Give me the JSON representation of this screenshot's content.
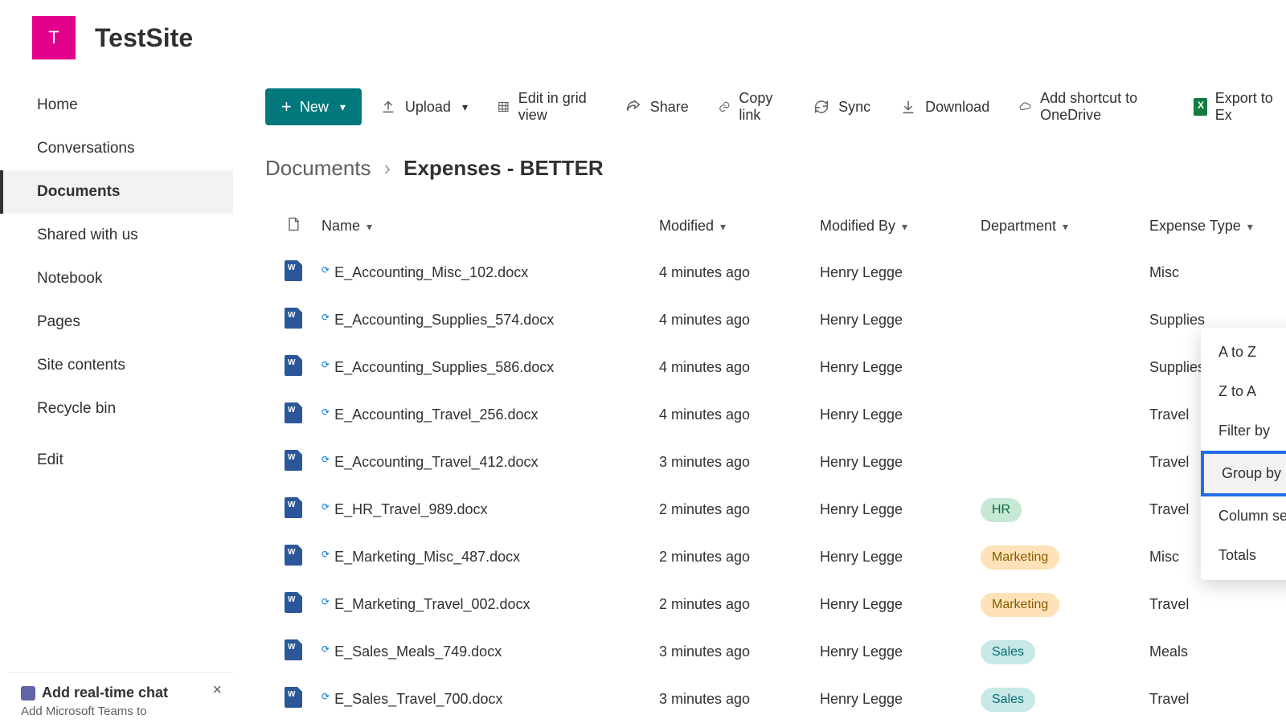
{
  "header": {
    "logo_letter": "T",
    "site_title": "TestSite"
  },
  "sidebar": {
    "items": [
      "Home",
      "Conversations",
      "Documents",
      "Shared with us",
      "Notebook",
      "Pages",
      "Site contents",
      "Recycle bin"
    ],
    "active_index": 2,
    "edit_label": "Edit"
  },
  "toolbar": {
    "new_label": "New",
    "upload_label": "Upload",
    "edit_grid_label": "Edit in grid view",
    "share_label": "Share",
    "copy_link_label": "Copy link",
    "sync_label": "Sync",
    "download_label": "Download",
    "shortcut_label": "Add shortcut to OneDrive",
    "export_label": "Export to Ex"
  },
  "breadcrumb": {
    "root": "Documents",
    "current": "Expenses - BETTER"
  },
  "columns": {
    "name": "Name",
    "modified": "Modified",
    "modified_by": "Modified By",
    "department": "Department",
    "expense_type": "Expense Type"
  },
  "rows": [
    {
      "name": "E_Accounting_Misc_102.docx",
      "modified": "4 minutes ago",
      "by": "Henry Legge",
      "dept": "",
      "exp": "Misc"
    },
    {
      "name": "E_Accounting_Supplies_574.docx",
      "modified": "4 minutes ago",
      "by": "Henry Legge",
      "dept": "",
      "exp": "Supplies"
    },
    {
      "name": "E_Accounting_Supplies_586.docx",
      "modified": "4 minutes ago",
      "by": "Henry Legge",
      "dept": "",
      "exp": "Supplies"
    },
    {
      "name": "E_Accounting_Travel_256.docx",
      "modified": "4 minutes ago",
      "by": "Henry Legge",
      "dept": "",
      "exp": "Travel"
    },
    {
      "name": "E_Accounting_Travel_412.docx",
      "modified": "3 minutes ago",
      "by": "Henry Legge",
      "dept": "",
      "exp": "Travel"
    },
    {
      "name": "E_HR_Travel_989.docx",
      "modified": "2 minutes ago",
      "by": "Henry Legge",
      "dept": "HR",
      "exp": "Travel"
    },
    {
      "name": "E_Marketing_Misc_487.docx",
      "modified": "2 minutes ago",
      "by": "Henry Legge",
      "dept": "Marketing",
      "exp": "Misc"
    },
    {
      "name": "E_Marketing_Travel_002.docx",
      "modified": "2 minutes ago",
      "by": "Henry Legge",
      "dept": "Marketing",
      "exp": "Travel"
    },
    {
      "name": "E_Sales_Meals_749.docx",
      "modified": "3 minutes ago",
      "by": "Henry Legge",
      "dept": "Sales",
      "exp": "Meals"
    },
    {
      "name": "E_Sales_Travel_700.docx",
      "modified": "3 minutes ago",
      "by": "Henry Legge",
      "dept": "Sales",
      "exp": "Travel"
    }
  ],
  "dropdown": {
    "items": [
      "A to Z",
      "Z to A",
      "Filter by",
      "Group by Department",
      "Column settings",
      "Totals"
    ],
    "highlighted_index": 3,
    "submenu_indices": [
      4,
      5
    ]
  },
  "chat": {
    "title": "Add real-time chat",
    "subtitle": "Add Microsoft Teams to"
  },
  "pill_classes": {
    "HR": "hr",
    "Marketing": "marketing",
    "Sales": "sales"
  }
}
